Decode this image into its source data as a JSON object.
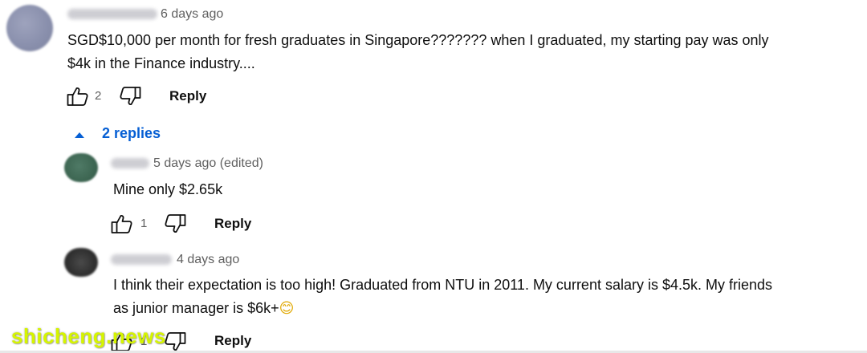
{
  "comment": {
    "timestamp": "6 days ago",
    "text_line1": "SGD$10,000 per month for fresh graduates in Singapore??????? when I graduated, my starting pay was only",
    "text_line2": "$4k in the Finance industry....",
    "likes": "2",
    "reply_label": "Reply"
  },
  "replies_toggle": {
    "label": "2 replies",
    "icon": "caret-up-icon"
  },
  "replies": [
    {
      "timestamp": "5 days ago (edited)",
      "text_line1": "Mine only $2.65k",
      "likes": "1",
      "reply_label": "Reply"
    },
    {
      "timestamp": "4 days ago",
      "text_line1": "I think their expectation is too high! Graduated from NTU in 2011. My current salary is $4.5k. My friends",
      "text_line2": "as junior manager is $6k+",
      "emoji": "😊",
      "likes": "1",
      "reply_label": "Reply"
    }
  ],
  "watermark": "shicheng.news",
  "colors": {
    "link_blue": "#065fd4",
    "meta_gray": "#606060",
    "watermark": "#d6f500"
  }
}
